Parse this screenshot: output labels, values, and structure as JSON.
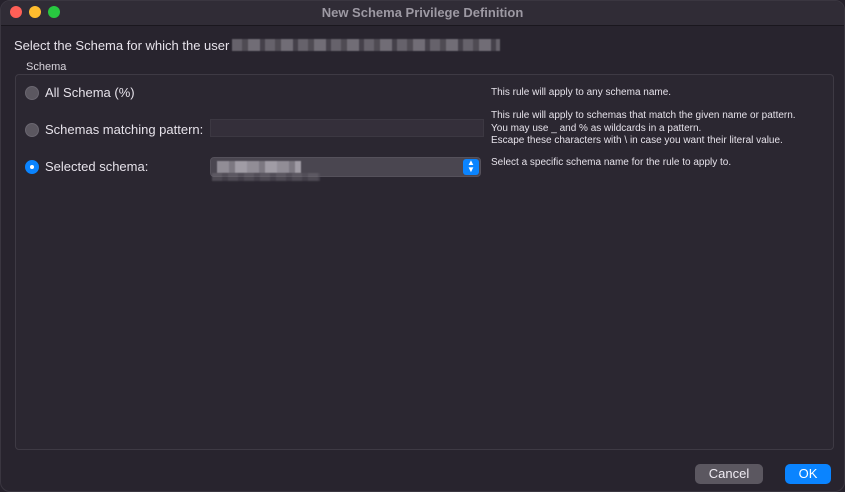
{
  "window": {
    "title": "New Schema Privilege Definition"
  },
  "prompt": {
    "text": "Select the Schema for which the user"
  },
  "schema_group": {
    "label": "Schema",
    "options": [
      {
        "label": "All Schema (%)",
        "selected": false,
        "description": "This rule will apply to any schema name."
      },
      {
        "label": "Schemas matching pattern:",
        "selected": false,
        "description_lines": [
          "This rule will apply to schemas that match the given name or pattern.",
          "You may use _ and % as wildcards in a pattern.",
          "Escape these characters with \\ in case you want their literal value."
        ],
        "input_value": ""
      },
      {
        "label": "Selected schema:",
        "selected": true,
        "description": "Select a specific schema name for the rule to apply to."
      }
    ]
  },
  "buttons": {
    "cancel": "Cancel",
    "ok": "OK"
  },
  "colors": {
    "accent": "#0a84ff",
    "close": "#fe5f57",
    "minimize": "#febc2e",
    "maximize": "#28c840"
  }
}
